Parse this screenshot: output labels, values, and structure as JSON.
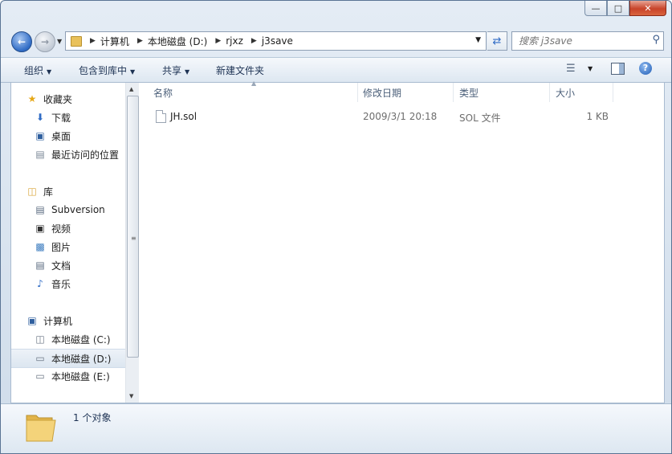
{
  "address": {
    "crumbs": [
      "计算机",
      "本地磁盘 (D:)",
      "rjxz",
      "j3save"
    ]
  },
  "search": {
    "placeholder": "搜索 j3save"
  },
  "toolbar": {
    "organize": "组织",
    "include_in_library": "包含到库中",
    "share": "共享",
    "new_folder": "新建文件夹"
  },
  "nav": {
    "favorites": "收藏夹",
    "downloads": "下载",
    "desktop": "桌面",
    "recent": "最近访问的位置",
    "libraries": "库",
    "subversion": "Subversion",
    "videos": "视频",
    "pictures": "图片",
    "documents": "文档",
    "music": "音乐",
    "computer": "计算机",
    "drive_c": "本地磁盘 (C:)",
    "drive_d": "本地磁盘 (D:)",
    "drive_e": "本地磁盘 (E:)"
  },
  "columns": {
    "name": "名称",
    "modified": "修改日期",
    "type": "类型",
    "size": "大小"
  },
  "files": [
    {
      "name": "JH.sol",
      "modified": "2009/3/1 20:18",
      "type": "SOL 文件",
      "size": "1 KB"
    }
  ],
  "status": {
    "count": "1 个对象"
  }
}
